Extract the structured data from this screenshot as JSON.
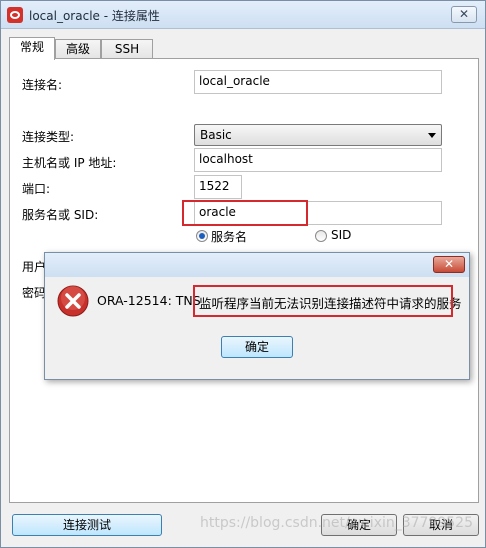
{
  "window": {
    "title": "local_oracle - 连接属性",
    "close_glyph": "✕"
  },
  "tabs": [
    {
      "label": "常规"
    },
    {
      "label": "高级"
    },
    {
      "label": "SSH"
    }
  ],
  "form": {
    "connection_name_label": "连接名:",
    "connection_name_value": "local_oracle",
    "connection_type_label": "连接类型:",
    "connection_type_value": "Basic",
    "host_label": "主机名或 IP 地址:",
    "host_value": "localhost",
    "port_label": "端口:",
    "port_value": "1522",
    "service_label": "服务名或 SID:",
    "service_value": "oracle",
    "radio_service_name": "服务名",
    "radio_sid": "SID",
    "selected_radio": "服务名",
    "user_label_partial": "用户",
    "password_label_partial": "密码"
  },
  "error_dialog": {
    "close_glyph": "✕",
    "message_prefix": "ORA-12514: TNS",
    "message_highlight": "监听程序当前无法识别连接描述符中请求的服务",
    "ok_label": "确定",
    "icon": "error-icon"
  },
  "footer": {
    "test_button": "连接测试",
    "ok_button": "确定",
    "cancel_button": "取消"
  },
  "watermark": "https://blog.csdn.net/weixin_37799525",
  "colors": {
    "highlight_red": "#d42a2f",
    "error_red": "#c8302c",
    "radio_selected": "#1d5fbf"
  }
}
